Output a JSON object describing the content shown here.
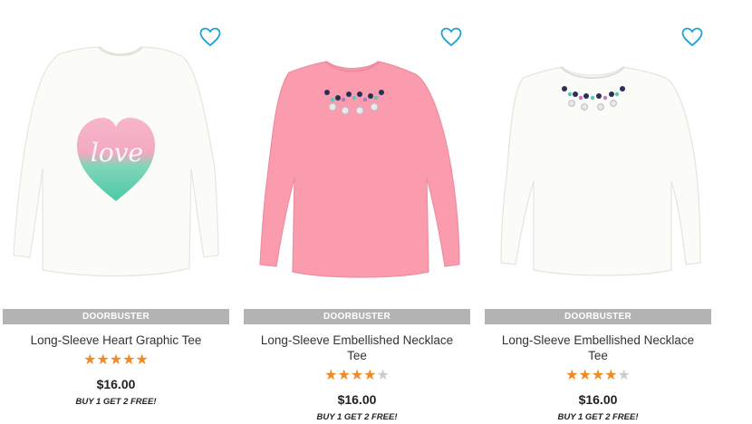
{
  "products": [
    {
      "badge": "DOORBUSTER",
      "name": "Long-Sleeve Heart Graphic Tee",
      "rating": 5,
      "price": "$16.00",
      "promo": "BUY 1 GET 2 FREE!",
      "shirt_color": "#fbfbf7",
      "graphic_text": "love",
      "favorite_icon": "heart-outline-icon"
    },
    {
      "badge": "DOORBUSTER",
      "name": "Long-Sleeve Embellished Necklace Tee",
      "rating": 4.5,
      "price": "$16.00",
      "promo": "BUY 1 GET 2 FREE!",
      "shirt_color": "#fa9cae",
      "favorite_icon": "heart-outline-icon"
    },
    {
      "badge": "DOORBUSTER",
      "name": "Long-Sleeve Embellished Necklace Tee",
      "rating": 4.5,
      "price": "$16.00",
      "promo": "BUY 1 GET 2 FREE!",
      "shirt_color": "#fbfbf8",
      "favorite_icon": "heart-outline-icon"
    }
  ],
  "colors": {
    "accent_heart": "#1ba2d6",
    "badge_bg": "#b3b3b3",
    "star_filled": "#f08a24",
    "star_empty": "#cccccc"
  }
}
